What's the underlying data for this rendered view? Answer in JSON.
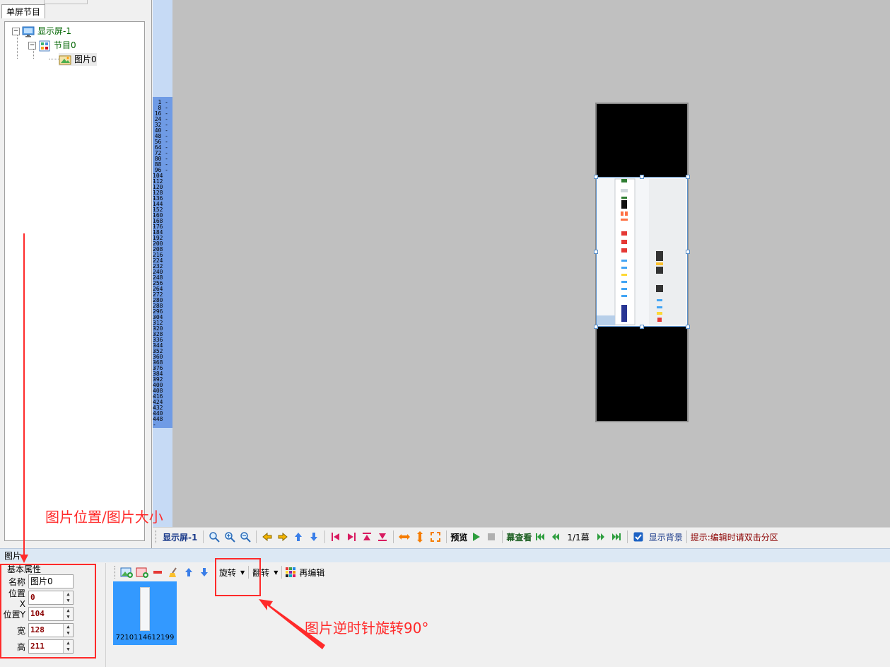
{
  "left_panel": {
    "tabs": [
      "单屏节目",
      ""
    ],
    "tree": [
      {
        "label": "显示屏-1",
        "level": 0,
        "icon": "monitor-icon",
        "expander": "−"
      },
      {
        "label": "节目0",
        "level": 1,
        "icon": "program-icon",
        "expander": "−"
      },
      {
        "label": "图片0",
        "level": 2,
        "icon": "image-icon",
        "expander": ""
      }
    ]
  },
  "ruler": {
    "labels": [
      "1",
      "8",
      "16",
      "24",
      "32",
      "40",
      "48",
      "56",
      "64",
      "72",
      "80",
      "88",
      "96",
      "104",
      "112",
      "120",
      "128",
      "136",
      "144",
      "152",
      "160",
      "168",
      "176",
      "184",
      "192",
      "200",
      "208",
      "216",
      "224",
      "232",
      "240",
      "248",
      "256",
      "264",
      "272",
      "280",
      "288",
      "296",
      "304",
      "312",
      "320",
      "328",
      "336",
      "344",
      "352",
      "360",
      "368",
      "376",
      "384",
      "392",
      "400",
      "408",
      "416",
      "424",
      "432",
      "440",
      "448"
    ]
  },
  "canvas_toolbar": {
    "screen_label": "显示屏-1",
    "preview_label": "预览",
    "scene_label": "幕查看",
    "page_indicator": "1/1幕",
    "show_bg_label": "显示背景",
    "show_bg_checked": true,
    "hint": "提示:编辑时请双击分区"
  },
  "section_bar": {
    "title": "图片"
  },
  "props": {
    "group_title": "基本属性",
    "name_label": "名称",
    "name_value": "图片0",
    "x_label": "位置X",
    "x_value": "0",
    "y_label": "位置Y",
    "y_value": "104",
    "width_label": "宽",
    "width_value": "128",
    "height_label": "高",
    "height_value": "211"
  },
  "media_toolbar": {
    "rotate_label": "旋转",
    "flip_label": "翻转",
    "reedit_label": "再编辑"
  },
  "thumbnail": {
    "caption": "7210114612199"
  },
  "annotations": {
    "position_size": "图片位置/图片大小",
    "rotate_note": "图片逆时针旋转90°"
  },
  "colors": {
    "annotation": "#ff2a2a",
    "ruler": "#6f9be5",
    "canvas_bg": "#c0c0c0",
    "thumb_bg": "#3399ff"
  }
}
